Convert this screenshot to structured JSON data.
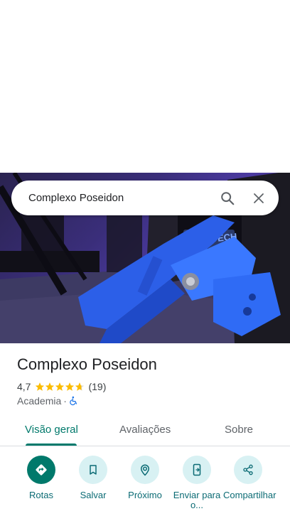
{
  "search": {
    "query": "Complexo Poseidon"
  },
  "hero": {
    "sign_text": "IRON TECH"
  },
  "place": {
    "name": "Complexo Poseidon",
    "rating": "4,7",
    "rating_value": 4.7,
    "stars_max": 5,
    "review_count": "(19)",
    "category": "Academia",
    "separator": "·"
  },
  "tabs": [
    {
      "label": "Visão geral",
      "active": true
    },
    {
      "label": "Avaliações",
      "active": false
    },
    {
      "label": "Sobre",
      "active": false
    }
  ],
  "actions": [
    {
      "label": "Rotas",
      "icon": "directions-icon"
    },
    {
      "label": "Salvar",
      "icon": "bookmark-icon"
    },
    {
      "label": "Próximo",
      "icon": "nearby-icon"
    },
    {
      "label": "Enviar para o...",
      "icon": "send-to-phone-icon"
    },
    {
      "label": "Compartilhar",
      "icon": "share-icon"
    }
  ],
  "colors": {
    "accent": "#00796b",
    "star": "#fbbc04",
    "action_bg": "#d8f1f3",
    "accessibility_icon": "#1a73e8"
  }
}
